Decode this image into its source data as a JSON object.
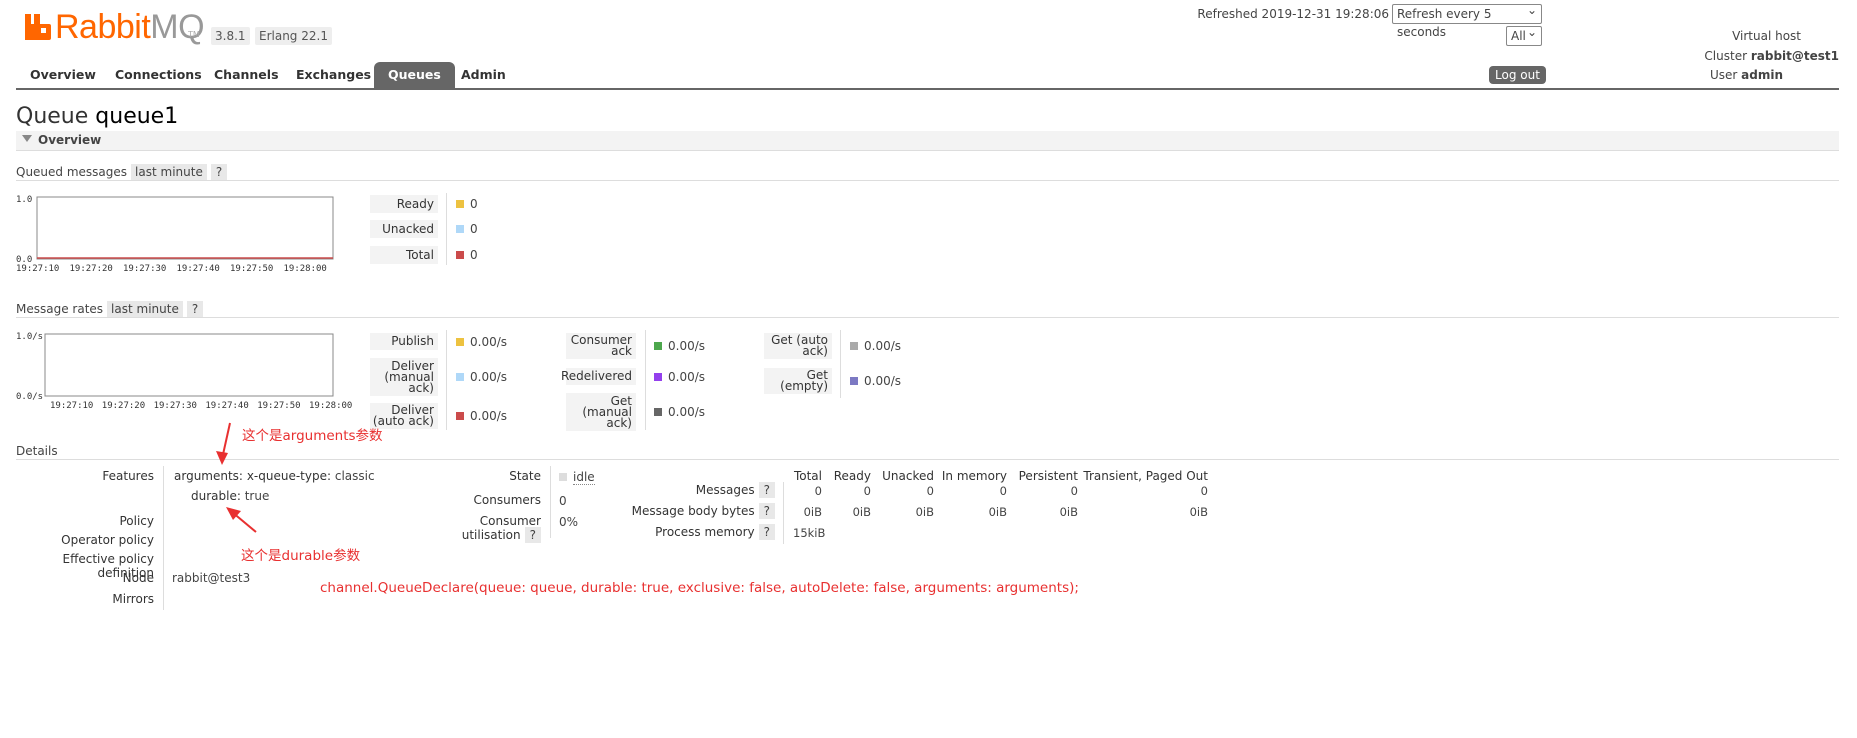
{
  "app": {
    "logo_prefix": "Rabbit",
    "logo_suffix": "MQ",
    "logo_tm": "TM",
    "version": "3.8.1",
    "erlang": "Erlang 22.1"
  },
  "header": {
    "refreshed_label": "Refreshed 2019-12-31 19:28:06",
    "refresh_select": "Refresh every 5 seconds",
    "vhost_label": "Virtual host",
    "vhost_select": "All",
    "cluster_label": "Cluster",
    "cluster_name": "rabbit@test1",
    "user_label": "User",
    "user_name": "admin",
    "logout": "Log out"
  },
  "tabs": [
    "Overview",
    "Connections",
    "Channels",
    "Exchanges",
    "Queues",
    "Admin"
  ],
  "active_tab": "Queues",
  "page": {
    "title_prefix": "Queue",
    "title_name": "queue1",
    "section": "Overview"
  },
  "queued": {
    "heading": "Queued messages",
    "range": "last minute",
    "help": "?",
    "y_max": "1.0",
    "y_min": "0.0",
    "x_ticks": [
      "19:27:10",
      "19:27:20",
      "19:27:30",
      "19:27:40",
      "19:27:50",
      "19:28:00"
    ],
    "stats": [
      {
        "label": "Ready",
        "value": "0",
        "color": "#edc240"
      },
      {
        "label": "Unacked",
        "value": "0",
        "color": "#afd8f8"
      },
      {
        "label": "Total",
        "value": "0",
        "color": "#cb4b4b"
      }
    ]
  },
  "rates": {
    "heading": "Message rates",
    "range": "last minute",
    "help": "?",
    "y_max": "1.0/s",
    "y_min": "0.0/s",
    "x_ticks": [
      "19:27:10",
      "19:27:20",
      "19:27:30",
      "19:27:40",
      "19:27:50",
      "19:28:00"
    ],
    "col1": [
      {
        "label": "Publish",
        "value": "0.00/s",
        "color": "#edc240"
      },
      {
        "label": "Deliver (manual ack)",
        "value": "0.00/s",
        "color": "#afd8f8"
      },
      {
        "label": "Deliver (auto ack)",
        "value": "0.00/s",
        "color": "#cb4b4b"
      }
    ],
    "col2": [
      {
        "label": "Consumer ack",
        "value": "0.00/s",
        "color": "#4da74d"
      },
      {
        "label": "Redelivered",
        "value": "0.00/s",
        "color": "#9440ed"
      },
      {
        "label": "Get (manual ack)",
        "value": "0.00/s",
        "color": "#666666"
      }
    ],
    "col3": [
      {
        "label": "Get (auto ack)",
        "value": "0.00/s",
        "color": "#aaaaaa"
      },
      {
        "label": "Get (empty)",
        "value": "0.00/s",
        "color": "#7c79c3"
      }
    ]
  },
  "details": {
    "heading": "Details",
    "features_label": "Features",
    "arguments_key": "arguments:",
    "arguments_val_key": "x-queue-type:",
    "arguments_val": "classic",
    "durable_key": "durable:",
    "durable_val": "true",
    "policy_label": "Policy",
    "operator_policy_label": "Operator policy",
    "effective_policy_label": "Effective policy definition",
    "node_label": "Node",
    "node_val": "rabbit@test3",
    "mirrors_label": "Mirrors",
    "state_label": "State",
    "state_val": "idle",
    "consumers_label": "Consumers",
    "consumers_val": "0",
    "consumer_util_label": "Consumer utilisation",
    "consumer_util_val": "0%",
    "help": "?",
    "table_headers": [
      "Total",
      "Ready",
      "Unacked",
      "In memory",
      "Persistent",
      "Transient, Paged Out"
    ],
    "rows": [
      {
        "label": "Messages",
        "values": [
          "0",
          "0",
          "0",
          "0",
          "0",
          "0"
        ]
      },
      {
        "label": "Message body bytes",
        "values": [
          "0iB",
          "0iB",
          "0iB",
          "0iB",
          "0iB",
          "0iB"
        ]
      },
      {
        "label": "Process memory",
        "values": [
          "15kiB"
        ]
      }
    ]
  },
  "annotations": {
    "arguments_note": "这个是arguments参数",
    "durable_note": "这个是durable参数",
    "code": "channel.QueueDeclare(queue: queue, durable: true, exclusive: false, autoDelete: false, arguments: arguments);"
  }
}
